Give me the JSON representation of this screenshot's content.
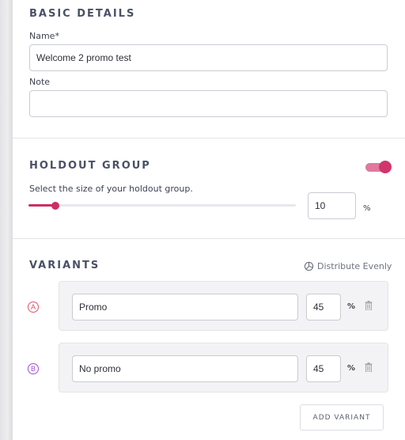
{
  "basic_details": {
    "title": "BASIC DETAILS",
    "name_label": "Name*",
    "name_value": "Welcome 2 promo test",
    "note_label": "Note",
    "note_value": ""
  },
  "holdout_group": {
    "title": "HOLDOUT GROUP",
    "toggle_on": true,
    "description": "Select the size of your holdout group.",
    "slider_value_percent": 10,
    "size_value": "10",
    "percent_sign": "%"
  },
  "variants": {
    "title": "VARIANTS",
    "distribute_label": "Distribute Evenly",
    "items": [
      {
        "letter": "A",
        "name": "Promo",
        "percent": "45",
        "percent_sign": "%",
        "letter_color": "#e0506a"
      },
      {
        "letter": "B",
        "name": "No promo",
        "percent": "45",
        "percent_sign": "%",
        "letter_color": "#9b4fd0"
      }
    ],
    "add_label": "ADD VARIANT"
  },
  "colors": {
    "accent": "#cc2e63",
    "toggle_track": "#e0799d"
  }
}
